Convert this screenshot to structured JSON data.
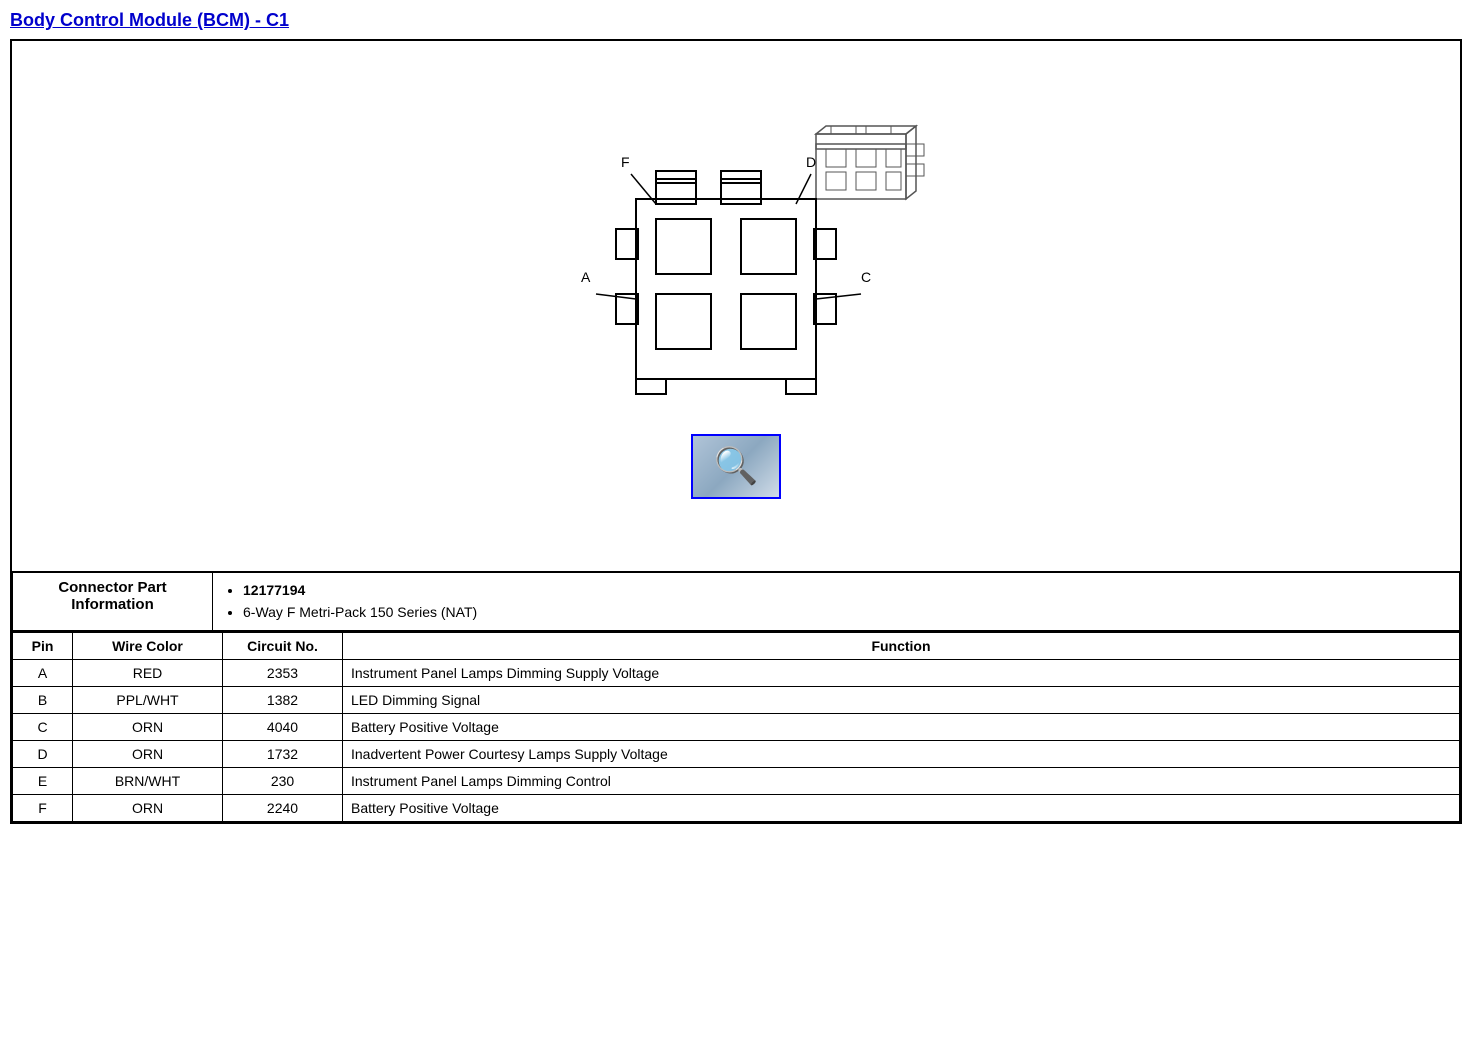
{
  "title": "Body Control Module (BCM) - C1",
  "connector_info": {
    "header": "Connector Part Information",
    "parts": [
      "12177194",
      "6-Way F Metri-Pack 150 Series (NAT)"
    ]
  },
  "table_headers": {
    "pin": "Pin",
    "wire_color": "Wire Color",
    "circuit_no": "Circuit No.",
    "function": "Function"
  },
  "pins": [
    {
      "pin": "A",
      "wire_color": "RED",
      "circuit_no": "2353",
      "function": "Instrument Panel Lamps Dimming Supply Voltage"
    },
    {
      "pin": "B",
      "wire_color": "PPL/WHT",
      "circuit_no": "1382",
      "function": "LED Dimming Signal"
    },
    {
      "pin": "C",
      "wire_color": "ORN",
      "circuit_no": "4040",
      "function": "Battery Positive Voltage"
    },
    {
      "pin": "D",
      "wire_color": "ORN",
      "circuit_no": "1732",
      "function": "Inadvertent Power Courtesy Lamps Supply Voltage"
    },
    {
      "pin": "E",
      "wire_color": "BRN/WHT",
      "circuit_no": "230",
      "function": "Instrument Panel Lamps Dimming Control"
    },
    {
      "pin": "F",
      "wire_color": "ORN",
      "circuit_no": "2240",
      "function": "Battery Positive Voltage"
    }
  ],
  "diagram_labels": {
    "f": "F",
    "d": "D",
    "a": "A",
    "c": "C"
  }
}
